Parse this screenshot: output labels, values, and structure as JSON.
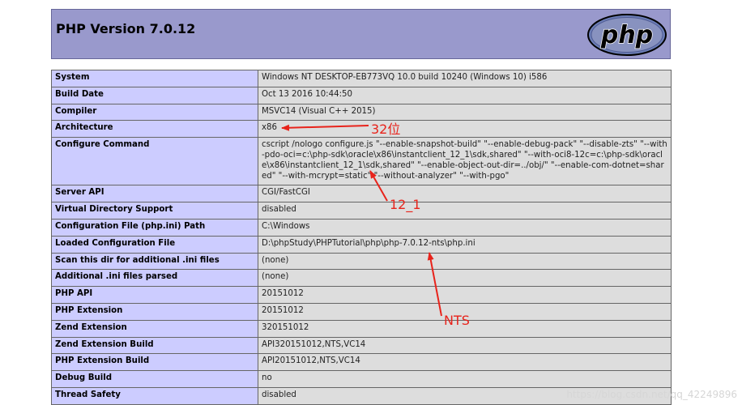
{
  "header": {
    "title": "PHP Version 7.0.12",
    "logo_text": "php"
  },
  "rows": [
    {
      "label": "System",
      "value": "Windows NT DESKTOP-EB773VQ 10.0 build 10240 (Windows 10) i586"
    },
    {
      "label": "Build Date",
      "value": "Oct 13 2016 10:44:50"
    },
    {
      "label": "Compiler",
      "value": "MSVC14 (Visual C++ 2015)"
    },
    {
      "label": "Architecture",
      "value": "x86"
    },
    {
      "label": "Configure Command",
      "value": "cscript /nologo configure.js \"--enable-snapshot-build\" \"--enable-debug-pack\" \"--disable-zts\" \"--with-pdo-oci=c:\\php-sdk\\oracle\\x86\\instantclient_12_1\\sdk,shared\" \"--with-oci8-12c=c:\\php-sdk\\oracle\\x86\\instantclient_12_1\\sdk,shared\" \"--enable-object-out-dir=../obj/\" \"--enable-com-dotnet=shared\" \"--with-mcrypt=static\" \"--without-analyzer\" \"--with-pgo\""
    },
    {
      "label": "Server API",
      "value": "CGI/FastCGI"
    },
    {
      "label": "Virtual Directory Support",
      "value": "disabled"
    },
    {
      "label": "Configuration File (php.ini) Path",
      "value": "C:\\Windows"
    },
    {
      "label": "Loaded Configuration File",
      "value": "D:\\phpStudy\\PHPTutorial\\php\\php-7.0.12-nts\\php.ini"
    },
    {
      "label": "Scan this dir for additional .ini files",
      "value": "(none)"
    },
    {
      "label": "Additional .ini files parsed",
      "value": "(none)"
    },
    {
      "label": "PHP API",
      "value": "20151012"
    },
    {
      "label": "PHP Extension",
      "value": "20151012"
    },
    {
      "label": "Zend Extension",
      "value": "320151012"
    },
    {
      "label": "Zend Extension Build",
      "value": "API320151012,NTS,VC14"
    },
    {
      "label": "PHP Extension Build",
      "value": "API20151012,NTS,VC14"
    },
    {
      "label": "Debug Build",
      "value": "no"
    },
    {
      "label": "Thread Safety",
      "value": "disabled"
    }
  ],
  "annotations": {
    "arch": "32位",
    "version": "12_1",
    "nts": "NTS"
  },
  "watermark": "https://blog.csdn.net/qq_42249896",
  "colors": {
    "header_bg": "#9999cc",
    "label_bg": "#ccccff",
    "value_bg": "#dddddd",
    "annotation": "#e8231b"
  }
}
